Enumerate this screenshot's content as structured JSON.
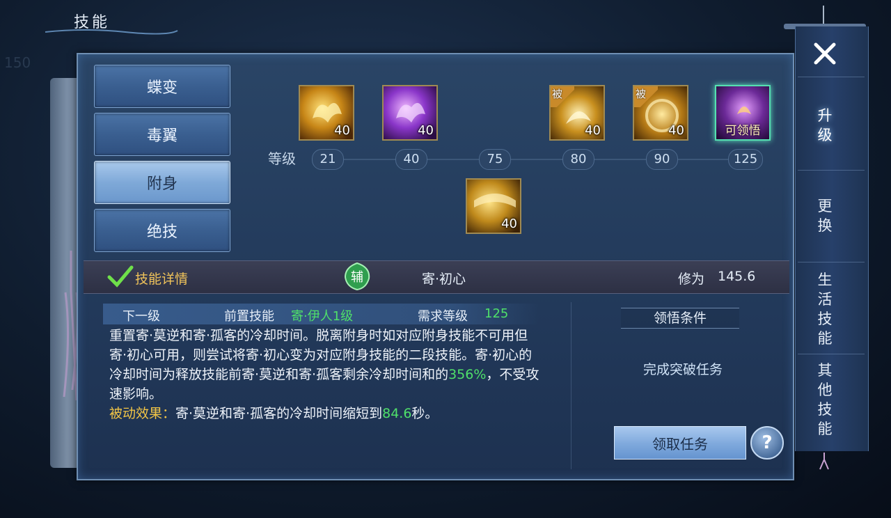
{
  "header": {
    "title": "技能"
  },
  "categories": [
    {
      "label": "蝶变",
      "active": false
    },
    {
      "label": "毒翼",
      "active": false
    },
    {
      "label": "附身",
      "active": true
    },
    {
      "label": "绝技",
      "active": false
    }
  ],
  "skill_tree": {
    "level_label": "等级",
    "levels": [
      "21",
      "40",
      "75",
      "80",
      "90",
      "125"
    ],
    "skills": [
      {
        "name": "skill-21",
        "badge": "40",
        "passive": "",
        "obtain": ""
      },
      {
        "name": "skill-40",
        "badge": "40",
        "passive": "",
        "obtain": ""
      },
      {
        "name": "skill-75",
        "badge": "40",
        "passive": "",
        "obtain": ""
      },
      {
        "name": "skill-80",
        "badge": "40",
        "passive": "被",
        "obtain": ""
      },
      {
        "name": "skill-90",
        "badge": "40",
        "passive": "被",
        "obtain": ""
      },
      {
        "name": "skill-125",
        "badge": "",
        "passive": "",
        "obtain": "可领悟"
      }
    ]
  },
  "info_bar": {
    "detail_label": "技能详情",
    "type_badge": "辅",
    "skill_name": "寄·初心",
    "cultivation_label": "修为",
    "cultivation_value": "145.6"
  },
  "next_level": {
    "label": "下一级",
    "prereq_label": "前置技能",
    "prereq_value": "寄·伊人1级",
    "req_level_label": "需求等级",
    "req_level_value": "125"
  },
  "description": {
    "part1": "重置寄·莫逆和寄·孤客的冷却时间。脱离附身时如对应附身技能不可用但寄·初心可用，则尝试将寄·初心变为对应附身技能的二段技能。寄·初心的冷却时间为释放技能前寄·莫逆和寄·孤客剩余冷却时间和的",
    "pct": "356%",
    "part2": "，不受攻速影响。",
    "passive_label": "被动效果：",
    "passive_text": "寄·莫逆和寄·孤客的冷却时间缩短到",
    "passive_value": "84.6",
    "passive_unit": "秒。"
  },
  "condition": {
    "title": "领悟条件",
    "text": "完成突破任务",
    "accept_label": "领取任务",
    "help_label": "?"
  },
  "nav": {
    "items": [
      "升级",
      "更换",
      "生活技能",
      "其他技能"
    ],
    "active_index": 0
  },
  "colors": {
    "accent_green": "#4fe06a",
    "accent_yellow": "#f2c546",
    "panel": "#22395a"
  }
}
